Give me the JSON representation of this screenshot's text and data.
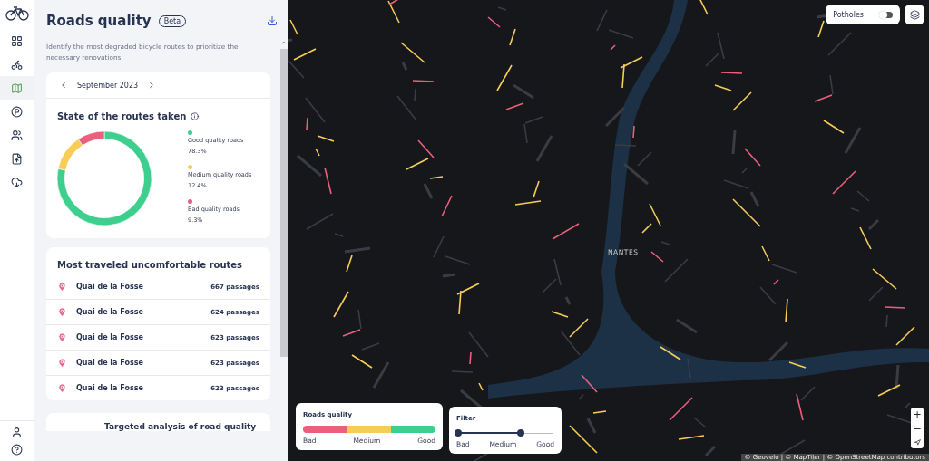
{
  "sidebar": {
    "items": [
      {
        "selected": false
      },
      {
        "selected": false
      },
      {
        "selected": true
      },
      {
        "selected": false
      },
      {
        "selected": false
      },
      {
        "selected": false
      },
      {
        "selected": false
      }
    ]
  },
  "panel": {
    "title": "Roads quality",
    "badge": "Beta",
    "description": "Identify the most degraded bicycle routes to prioritize the necessary renovations.",
    "period": "September 2023",
    "state_card": {
      "title": "State of the routes taken",
      "chart_data": {
        "type": "donut",
        "categories": [
          "Good quality roads",
          "Medium quality roads",
          "Bad quality roads"
        ],
        "values": [
          78.3,
          12.4,
          9.3
        ],
        "colors": [
          "#3ecf8e",
          "#f7cd58",
          "#ea5f7c"
        ],
        "value_labels": [
          "78.3%",
          "12.4%",
          "9.3%"
        ]
      }
    },
    "routes_card": {
      "title": "Most traveled uncomfortable routes",
      "rows": [
        {
          "name": "Quai de la Fosse",
          "count": "667 passages"
        },
        {
          "name": "Quai de la Fosse",
          "count": "624 passages"
        },
        {
          "name": "Quai de la Fosse",
          "count": "623 passages"
        },
        {
          "name": "Quai de la Fosse",
          "count": "623 passages"
        },
        {
          "name": "Quai de la Fosse",
          "count": "623 passages"
        }
      ]
    },
    "teaser_title": "Targeted analysis of road quality"
  },
  "map": {
    "city_label": "NANTES",
    "potholes": {
      "label": "Potholes",
      "on": false
    },
    "legend": {
      "title": "Roads quality",
      "labels": [
        "Bad",
        "Medium",
        "Good"
      ]
    },
    "filter": {
      "title": "Filter",
      "labels": [
        "Bad",
        "Medium",
        "Good"
      ],
      "thumbs": [
        {
          "level": 0
        },
        {
          "level": 0.66
        }
      ]
    },
    "zoom_in": "+",
    "zoom_out": "−",
    "attribution": "© Geovelo | © MapTiler | © OpenStreetMap contributors"
  }
}
